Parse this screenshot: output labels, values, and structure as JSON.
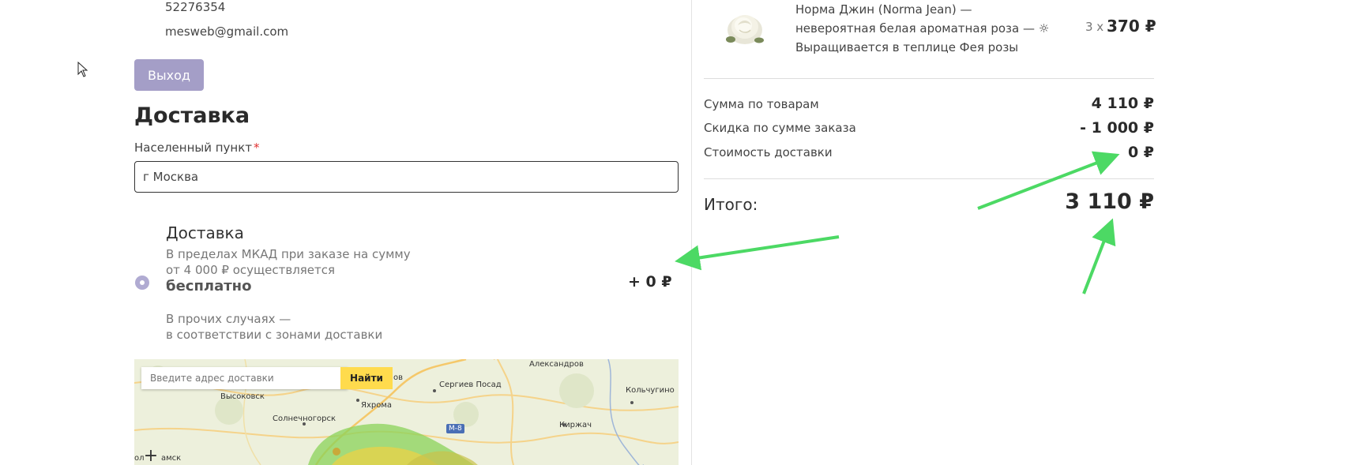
{
  "account": {
    "phone": "52276354",
    "email": "mesweb@gmail.com",
    "logout_label": "Выход"
  },
  "delivery": {
    "section_title": "Доставка",
    "city_label": "Населенный пункт",
    "required_mark": "*",
    "city_value": "г Москва",
    "option_name": "Доставка",
    "option_desc_line1": "В пределах МКАД при заказе на сумму",
    "option_desc_line2": "от 4 000 ₽ осуществляется",
    "option_free": "бесплатно",
    "option_price": "+ 0 ₽",
    "option_note_line1": "В прочих случаях —",
    "option_note_line2": "в соответствии с зонами доставки"
  },
  "map": {
    "search_placeholder": "Введите адрес доставки",
    "search_button": "Найти",
    "labels": {
      "aleksandrov": "Александров",
      "sergiev_posad": "Сергиев Посад",
      "vysokovsk": "Высоковск",
      "yakhroma": "Яхрома",
      "kolchugino": "Кольчугино",
      "solnechnogorsk": "Солнечногорск",
      "kirzhach": "Киржач",
      "ov": "ов",
      "klin_part": "ол",
      "amsk": "амск"
    },
    "road": "M-8",
    "zoom_in": "+"
  },
  "order": {
    "product_title_line1": "Норма Джин (Norma Jean) —",
    "product_title_line2": "невероятная белая ароматная роза — ☼",
    "product_title_line3": "Выращивается в теплице Фея розы",
    "qty": "3 x",
    "unit_price": "370 ₽",
    "items_sum_label": "Сумма по товарам",
    "items_sum_value": "4 110 ₽",
    "discount_label": "Скидка по сумме заказа",
    "discount_value": "- 1 000 ₽",
    "shipping_label": "Стоимость доставки",
    "shipping_value": "0 ₽",
    "total_label": "Итого:",
    "total_value": "3 110 ₽"
  },
  "colors": {
    "button_purple": "#a49ec7",
    "arrow_green": "#4cd964",
    "map_button_yellow": "#ffdb4d"
  }
}
